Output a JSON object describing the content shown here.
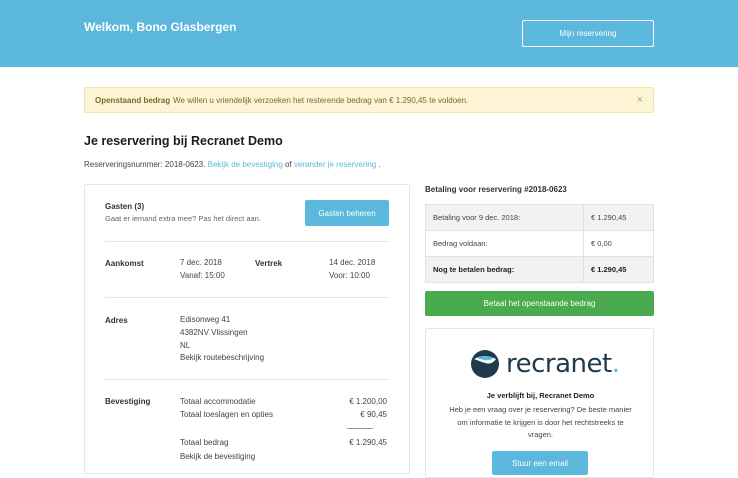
{
  "header": {
    "welcome": "Welkom, Bono Glasbergen",
    "my_reservation": "Mijn reservering"
  },
  "alert": {
    "title": "Openstaand bedrag",
    "message": "We willen u vriendelijk verzoeken het resterende bedrag van € 1.290,45 te voldoen.",
    "close": "×"
  },
  "page": {
    "title": "Je reservering bij Recranet Demo",
    "res_prefix": "Reserveringsnummer: 2018-0623.",
    "link_confirm": "Bekijk de bevestiging",
    "or": "of",
    "link_change": "verander je reservering",
    "period": "."
  },
  "guests": {
    "label": "Gasten (3)",
    "sub": "Gaat er iemand extra mee? Pas het direct aan.",
    "button": "Gasten beheren"
  },
  "arrival": {
    "label": "Aankomst",
    "date": "7 dec. 2018",
    "time": "Vanaf: 15:00"
  },
  "departure": {
    "label": "Vertrek",
    "date": "14 dec. 2018",
    "time": "Voor: 10:00"
  },
  "address": {
    "label": "Adres",
    "street": "Edisonweg 41",
    "city": "4382NV Vlissingen",
    "country": "NL",
    "route_link": "Bekijk routebeschrijving"
  },
  "confirmation": {
    "label": "Bevestiging",
    "rows": [
      {
        "name": "Totaal accommodatie",
        "amount": "€ 1.200,00"
      },
      {
        "name": "Totaal toeslagen en opties",
        "amount": "€ 90,45"
      }
    ],
    "total_name": "Totaal bedrag",
    "total_amount": "€ 1.290,45",
    "link": "Bekijk de bevestiging"
  },
  "payment": {
    "title": "Betaling voor reservering #2018-0623",
    "rows": [
      {
        "label": "Betaling voor 9 dec. 2018:",
        "amount": "€ 1.290,45"
      },
      {
        "label": "Bedrag voldaan:",
        "amount": "€ 0,00"
      },
      {
        "label": "Nog te betalen bedrag:",
        "amount": "€ 1.290,45"
      }
    ],
    "button": "Betaal het openstaande bedrag"
  },
  "brand": {
    "logo_text": "recranet",
    "logo_dot": ".",
    "stay": "Je verblijft bij, Recranet Demo",
    "sub": "Heb je een vraag over je reservering? De beste manier om informatie te krijgen is door het rechtstreeks te vragen.",
    "contact_button": "Stuur een email"
  },
  "colors": {
    "header": "#5bb8dc",
    "pay_button": "#4aab4e",
    "alert_bg": "#fcf4d4"
  }
}
